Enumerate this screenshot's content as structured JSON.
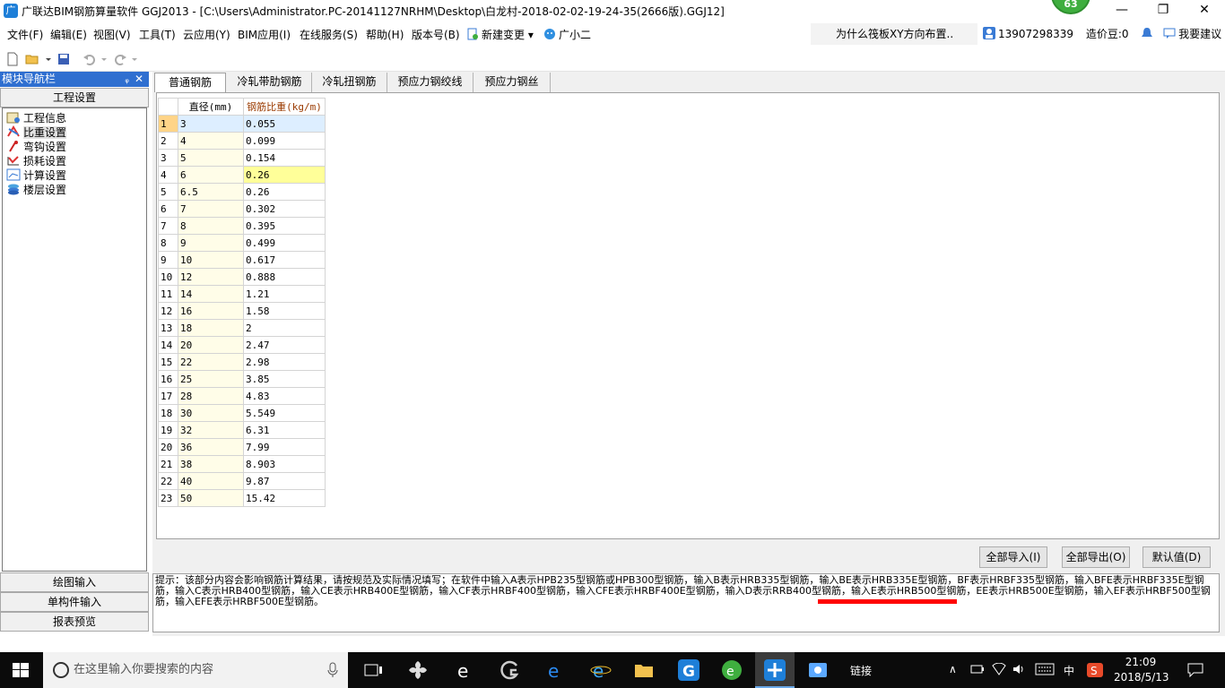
{
  "window": {
    "title": "广联达BIM钢筋算量软件 GGJ2013 - [C:\\Users\\Administrator.PC-20141127NRHM\\Desktop\\白龙村-2018-02-02-19-24-35(2666版).GGJ12]",
    "app_icon": "广",
    "score": "63",
    "minimize": "—",
    "maximize": "❐",
    "close": "✕"
  },
  "menu": {
    "items": [
      "文件(F)",
      "编辑(E)",
      "视图(V)",
      "工具(T)",
      "云应用(Y)",
      "BIM应用(I)",
      "在线服务(S)",
      "帮助(H)",
      "版本号(B)"
    ],
    "new_change": "新建变更",
    "new_change_arrow": "▾",
    "assistant": "广小二",
    "news": "为什么筏板XY方向布置..",
    "phone": "13907298339",
    "points": "造价豆:0",
    "suggest": "我要建议"
  },
  "sidebar": {
    "header": "模块导航栏",
    "pin": "ᵩ",
    "close": "✕",
    "section_top": "工程设置",
    "tree": [
      {
        "label": "工程信息",
        "icon": "info-icon"
      },
      {
        "label": "比重设置",
        "icon": "weight-icon"
      },
      {
        "label": "弯钩设置",
        "icon": "hook-icon"
      },
      {
        "label": "损耗设置",
        "icon": "loss-icon"
      },
      {
        "label": "计算设置",
        "icon": "calc-icon"
      },
      {
        "label": "楼层设置",
        "icon": "floor-icon"
      }
    ],
    "sections_bottom": [
      "绘图输入",
      "单构件输入",
      "报表预览"
    ]
  },
  "tabs": [
    "普通钢筋",
    "冷轧带肋钢筋",
    "冷轧扭钢筋",
    "预应力钢绞线",
    "预应力钢丝"
  ],
  "table": {
    "headers": [
      "直径(mm)",
      "钢筋比重(kg/m)"
    ],
    "rows": [
      [
        "1",
        "3",
        "0.055"
      ],
      [
        "2",
        "4",
        "0.099"
      ],
      [
        "3",
        "5",
        "0.154"
      ],
      [
        "4",
        "6",
        "0.26"
      ],
      [
        "5",
        "6.5",
        "0.26"
      ],
      [
        "6",
        "7",
        "0.302"
      ],
      [
        "7",
        "8",
        "0.395"
      ],
      [
        "8",
        "9",
        "0.499"
      ],
      [
        "9",
        "10",
        "0.617"
      ],
      [
        "10",
        "12",
        "0.888"
      ],
      [
        "11",
        "14",
        "1.21"
      ],
      [
        "12",
        "16",
        "1.58"
      ],
      [
        "13",
        "18",
        "2"
      ],
      [
        "14",
        "20",
        "2.47"
      ],
      [
        "15",
        "22",
        "2.98"
      ],
      [
        "16",
        "25",
        "3.85"
      ],
      [
        "17",
        "28",
        "4.83"
      ],
      [
        "18",
        "30",
        "5.549"
      ],
      [
        "19",
        "32",
        "6.31"
      ],
      [
        "20",
        "36",
        "7.99"
      ],
      [
        "21",
        "38",
        "8.903"
      ],
      [
        "22",
        "40",
        "9.87"
      ],
      [
        "23",
        "50",
        "15.42"
      ]
    ],
    "selected_row": 1,
    "highlight_row": 4
  },
  "buttons": {
    "import_all": "全部导入(I)",
    "export_all": "全部导出(O)",
    "default": "默认值(D)"
  },
  "hint": "提示：该部分内容会影响钢筋计算结果，请按规范及实际情况填写；在软件中输入A表示HPB235型钢筋或HPB300型钢筋，输入B表示HRB335型钢筋，输入BE表示HRB335E型钢筋，BF表示HRBF335型钢筋，输入BFE表示HRBF335E型钢筋，输入C表示HRB400型钢筋，输入CE表示HRB400E型钢筋，输入CF表示HRBF400型钢筋，输入CFE表示HRBF400E型钢筋，输入D表示RRB400型钢筋，输入E表示HRB500型钢筋，EE表示HRB500E型钢筋，输入EF表示HRBF500型钢筋，输入EFE表示HRBF500E型钢筋。",
  "taskbar": {
    "search_placeholder": "在这里输入你要搜索的内容",
    "link_label": "链接",
    "ime": "中",
    "time": "21:09",
    "date": "2018/5/13",
    "tray_chevron": "∧"
  },
  "colors": {
    "title_accent": "#2f6fd0",
    "header_highlight": "#ffd27a",
    "row_highlight": "#ffff99",
    "annotation_red": "#ff0000"
  }
}
